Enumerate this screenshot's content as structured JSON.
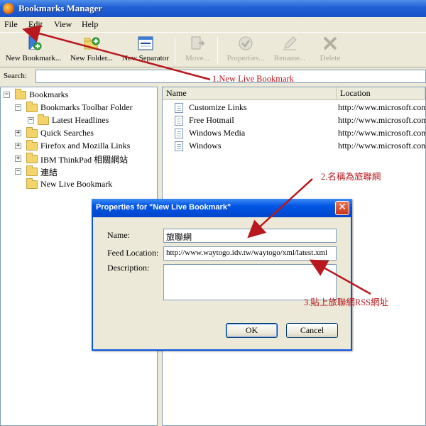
{
  "window": {
    "title": "Bookmarks Manager",
    "app_icon": "firefox-icon"
  },
  "menu": [
    "File",
    "Edit",
    "View",
    "Help"
  ],
  "toolbar": {
    "new_bookmark": "New Bookmark...",
    "new_folder": "New Folder...",
    "new_separator": "New Separator",
    "move": "Move...",
    "properties": "Properties...",
    "rename": "Rename...",
    "delete": "Delete"
  },
  "search": {
    "label": "Search:",
    "value": ""
  },
  "tree": {
    "root": "Bookmarks",
    "items": [
      {
        "label": "Bookmarks Toolbar Folder",
        "expanded": true
      },
      {
        "label": "Latest Headlines",
        "child": true
      },
      {
        "label": "Quick Searches",
        "expanded": false
      },
      {
        "label": "Firefox and Mozilla Links",
        "expanded": false
      },
      {
        "label": "IBM ThinkPad 相關網站",
        "expanded": false
      },
      {
        "label": "連結",
        "expanded": true
      },
      {
        "label": "New Live Bookmark",
        "child": false
      }
    ]
  },
  "list": {
    "columns": {
      "name": "Name",
      "location": "Location"
    },
    "rows": [
      {
        "name": "Customize Links",
        "location": "http://www.microsoft.com/"
      },
      {
        "name": "Free Hotmail",
        "location": "http://www.microsoft.com/"
      },
      {
        "name": "Windows Media",
        "location": "http://www.microsoft.com/"
      },
      {
        "name": "Windows",
        "location": "http://www.microsoft.com/"
      }
    ]
  },
  "dialog": {
    "title": "Properties for \"New Live Bookmark\"",
    "name_label": "Name:",
    "name_value": "旅聯網",
    "feed_label": "Feed Location:",
    "feed_value": "http://www.waytogo.idv.tw/waytogo/xml/latest.xml",
    "desc_label": "Description:",
    "desc_value": "",
    "ok": "OK",
    "cancel": "Cancel"
  },
  "annotations": {
    "step1": "1.New Live Bookmark",
    "step2": "2.名稱為旅聯網",
    "step3": "3.貼上旅聯網RSS網址",
    "color": "#b8181e"
  }
}
